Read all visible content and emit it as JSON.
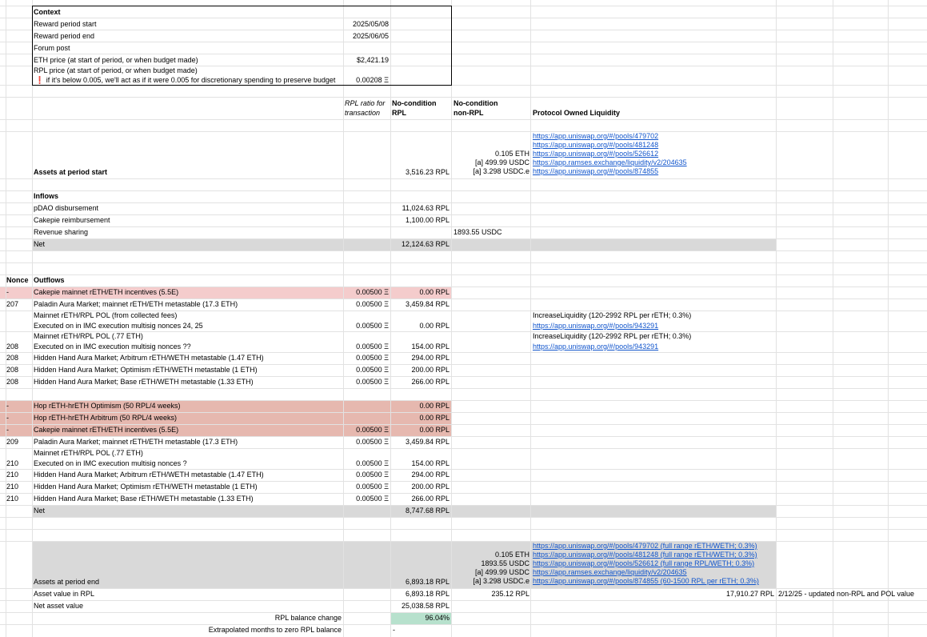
{
  "context": {
    "title": "Context",
    "rows": [
      {
        "label": "Reward period start",
        "value": "2025/05/08"
      },
      {
        "label": "Reward period end",
        "value": "2025/06/05"
      },
      {
        "label": "Forum post",
        "value": ""
      },
      {
        "label": "ETH price (at start of period, or when budget made)",
        "value": "$2,421.19"
      },
      {
        "label": "RPL price (at start of period, or when budget made)",
        "value": ""
      }
    ],
    "rpl_note": "if it's below 0.005, we'll act as if it were 0.005 for discretionary spending to preserve budget",
    "rpl_price": "0.00208 Ξ",
    "warning_icon": "exclamation-icon"
  },
  "headers": {
    "ratio_line1": "RPL ratio for",
    "ratio_line2": "transaction",
    "nocond_rpl_line1": "No-condition",
    "nocond_rpl_line2": "RPL",
    "nocond_nonrpl_line1": "No-condition",
    "nocond_nonrpl_line2": "non-RPL",
    "pol": "Protocol Owned Liquidity"
  },
  "start": {
    "label": "Assets at period start",
    "rpl": "3,516.23 RPL",
    "nonrpl": [
      "0.105 ETH",
      "[a] 499.99 USDC",
      "[a] 3.298 USDC.e"
    ],
    "links": [
      "https://app.uniswap.org/#/pools/479702",
      "https://app.uniswap.org/#/pools/481248",
      "https://app.uniswap.org/#/pools/526612",
      "https://app.ramses.exchange/liquidity/v2/204635",
      "https://app.uniswap.org/#/pools/874855"
    ]
  },
  "inflows": {
    "title": "Inflows",
    "rows": [
      {
        "label": "pDAO disbursement",
        "rpl": "11,024.63 RPL",
        "nonrpl": ""
      },
      {
        "label": "Cakepie reimbursement",
        "rpl": "1,100.00 RPL",
        "nonrpl": ""
      },
      {
        "label": "Revenue sharing",
        "rpl": "",
        "nonrpl": "1893.55 USDC"
      }
    ],
    "net_label": "Net",
    "net_rpl": "12,124.63 RPL"
  },
  "outflows": {
    "nonce_header": "Nonce",
    "title": "Outflows",
    "rows": [
      {
        "nonce": "-",
        "label": "Cakepie mainnet rETH/ETH incentives (5.5E)",
        "ratio": "0.00500 Ξ",
        "rpl": "0.00 RPL"
      },
      {
        "nonce": "207",
        "label": "Paladin Aura Market; mainnet rETH/ETH metastable (17.3 ETH)",
        "ratio": "0.00500 Ξ",
        "rpl": "3,459.84 RPL"
      },
      {
        "nonce": "",
        "label": "Mainnet rETH/RPL POL (from collected fees)",
        "label2": "Executed on in IMC execution multisig nonces 24, 25",
        "ratio": "0.00500 Ξ",
        "rpl": "0.00 RPL",
        "pol": "IncreaseLiquidity (120-2992 RPL per rETH; 0.3%)",
        "pol_link": "https://app.uniswap.org/#/pools/943291"
      },
      {
        "nonce": "208",
        "label": "Mainnet rETH/RPL POL (.77 ETH)",
        "label2": "Executed on in IMC execution multisig nonces ??",
        "ratio": "0.00500 Ξ",
        "rpl": "154.00 RPL",
        "pol": "IncreaseLiquidity (120-2992 RPL per rETH; 0.3%)",
        "pol_link": "https://app.uniswap.org/#/pools/943291"
      },
      {
        "nonce": "208",
        "label": "Hidden Hand Aura Market; Arbitrum rETH/WETH metastable (1.47 ETH)",
        "ratio": "0.00500 Ξ",
        "rpl": "294.00 RPL"
      },
      {
        "nonce": "208",
        "label": "Hidden Hand Aura Market; Optimism rETH/WETH metastable (1 ETH)",
        "ratio": "0.00500 Ξ",
        "rpl": "200.00 RPL"
      },
      {
        "nonce": "208",
        "label": "Hidden Hand Aura Market; Base rETH/WETH metastable (1.33 ETH)",
        "ratio": "0.00500 Ξ",
        "rpl": "266.00 RPL"
      },
      {
        "nonce": "-",
        "label": "Hop rETH-hrETH Optimism (50 RPL/4 weeks)",
        "ratio": "",
        "rpl": "0.00 RPL"
      },
      {
        "nonce": "-",
        "label": "Hop rETH-hrETH Arbitrum (50 RPL/4 weeks)",
        "ratio": "",
        "rpl": "0.00 RPL"
      },
      {
        "nonce": "-",
        "label": "Cakepie mainnet rETH/ETH incentives (5.5E)",
        "ratio": "0.00500 Ξ",
        "rpl": "0.00 RPL"
      },
      {
        "nonce": "209",
        "label": "Paladin Aura Market; mainnet rETH/ETH metastable (17.3 ETH)",
        "ratio": "0.00500 Ξ",
        "rpl": "3,459.84 RPL"
      },
      {
        "nonce": "210",
        "label": "Mainnet rETH/RPL POL (.77 ETH)",
        "label2": "Executed on in IMC execution multisig nonces ?",
        "ratio": "0.00500 Ξ",
        "rpl": "154.00 RPL"
      },
      {
        "nonce": "210",
        "label": "Hidden Hand Aura Market; Arbitrum rETH/WETH metastable (1.47 ETH)",
        "ratio": "0.00500 Ξ",
        "rpl": "294.00 RPL"
      },
      {
        "nonce": "210",
        "label": "Hidden Hand Aura Market; Optimism rETH/WETH metastable (1 ETH)",
        "ratio": "0.00500 Ξ",
        "rpl": "200.00 RPL"
      },
      {
        "nonce": "210",
        "label": "Hidden Hand Aura Market; Base rETH/WETH metastable (1.33 ETH)",
        "ratio": "0.00500 Ξ",
        "rpl": "266.00 RPL"
      }
    ],
    "net_label": "Net",
    "net_rpl": "8,747.68 RPL"
  },
  "end": {
    "label": "Assets at period end",
    "rpl": "6,893.18 RPL",
    "nonrpl": [
      "0.105 ETH",
      "1893.55 USDC",
      "[a] 499.99 USDC",
      "[a] 3.298 USDC.e"
    ],
    "links": [
      "https://app.uniswap.org/#/pools/479702 (full range rETH/WETH; 0.3%)",
      "https://app.uniswap.org/#/pools/481248 (full range rETH/WETH; 0.3%)",
      "https://app.uniswap.org/#/pools/526612 (full range RPL/WETH; 0.3%)",
      "https://app.ramses.exchange/liquidity/v2/204635",
      "https://app.uniswap.org/#/pools/874855 (60-1500 RPL per rETH; 0.3%)"
    ],
    "asset_value_label": "Asset value in RPL",
    "asset_value_rpl": "6,893.18 RPL",
    "asset_value_nonrpl": "235.12 RPL",
    "asset_value_pol": "17,910.27 RPL",
    "asset_value_note": "2/12/25 - updated non-RPL and POL value",
    "nav_label": "Net asset value",
    "nav_rpl": "25,038.58 RPL",
    "balance_change_label": "RPL balance change",
    "balance_change": "96.04%",
    "extrapolated_label": "Extrapolated months to zero RPL balance",
    "extrapolated_value": "-"
  },
  "colors": {
    "grid": "#e2e2e2",
    "net_fill": "#d9d9d9",
    "pink_light": "#f4cccc",
    "pink_dark": "#e6b8af",
    "green": "#b7e1cd",
    "link": "#1155cc",
    "warning": "#e53935"
  }
}
